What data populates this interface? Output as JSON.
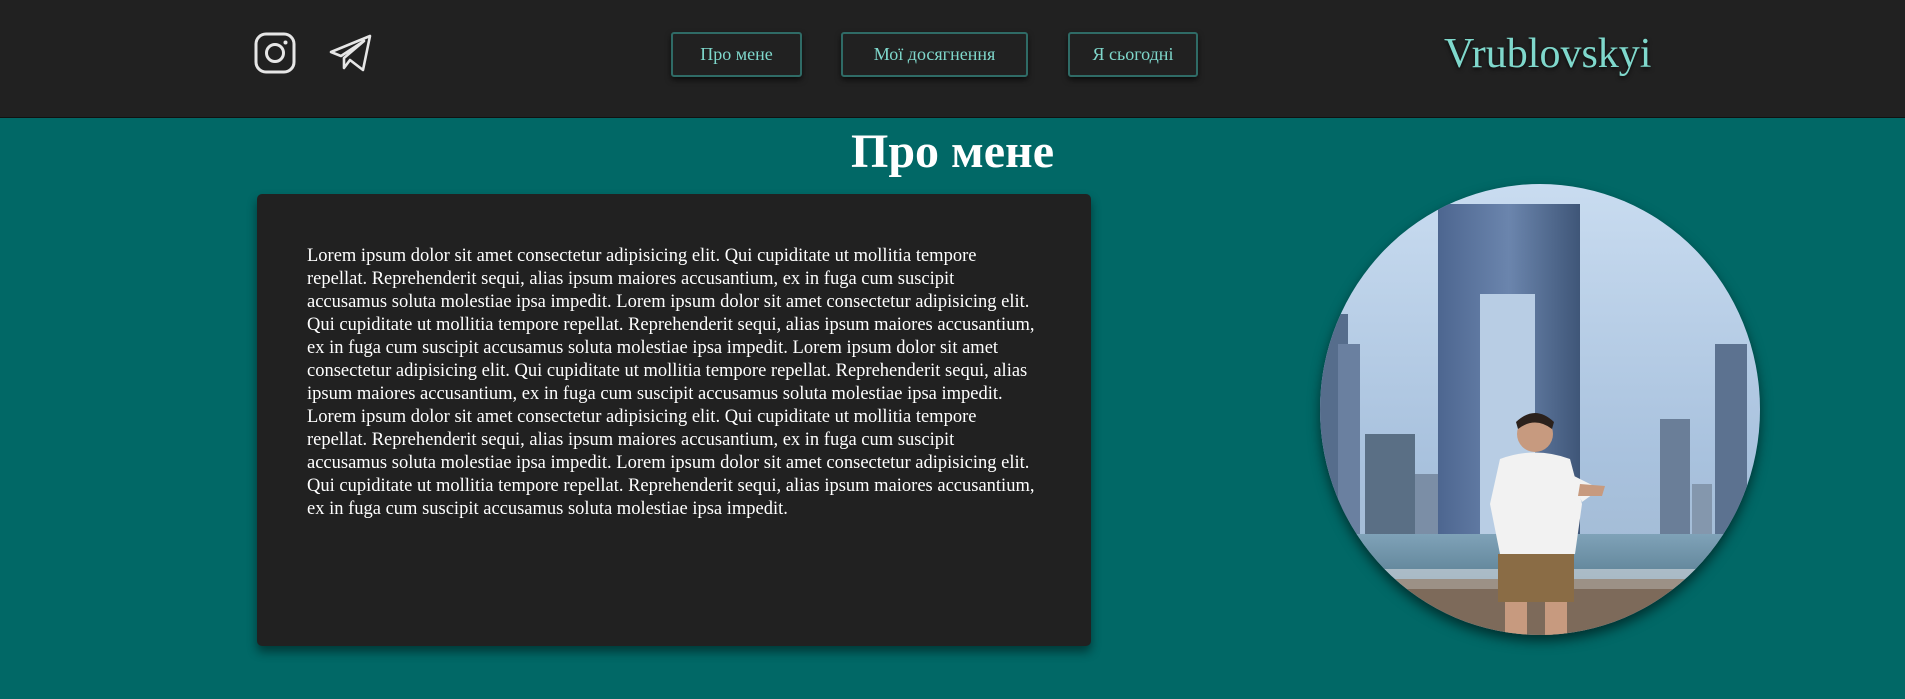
{
  "header": {
    "social": [
      {
        "name": "instagram-icon"
      },
      {
        "name": "telegram-icon"
      }
    ],
    "nav": [
      {
        "label": "Про мене"
      },
      {
        "label": "Мої досягнення"
      },
      {
        "label": "Я сьогодні"
      }
    ],
    "brand": "Vrublovskyi"
  },
  "main": {
    "title": "Про мене",
    "paragraph": "Lorem ipsum dolor sit amet consectetur adipisicing elit. Qui cupiditate ut mollitia tempore repellat. Reprehenderit sequi, alias ipsum maiores accusantium, ex in fuga cum suscipit accusamus soluta molestiae ipsa impedit. Lorem ipsum dolor sit amet consectetur adipisicing elit. Qui cupiditate ut mollitia tempore repellat. Reprehenderit sequi, alias ipsum maiores accusantium, ex in fuga cum suscipit accusamus soluta molestiae ipsa impedit. Lorem ipsum dolor sit amet consectetur adipisicing elit. Qui cupiditate ut mollitia tempore repellat. Reprehenderit sequi, alias ipsum maiores accusantium, ex in fuga cum suscipit accusamus soluta molestiae ipsa impedit. Lorem ipsum dolor sit amet consectetur adipisicing elit. Qui cupiditate ut mollitia tempore repellat. Reprehenderit sequi, alias ipsum maiores accusantium, ex in fuga cum suscipit accusamus soluta molestiae ipsa impedit. Lorem ipsum dolor sit amet consectetur adipisicing elit. Qui cupiditate ut mollitia tempore repellat. Reprehenderit sequi, alias ipsum maiores accusantium, ex in fuga cum suscipit accusamus soluta molestiae ipsa impedit."
  },
  "colors": {
    "background": "#016866",
    "header": "#212121",
    "accent": "#7fd8cc",
    "card": "#212121"
  }
}
